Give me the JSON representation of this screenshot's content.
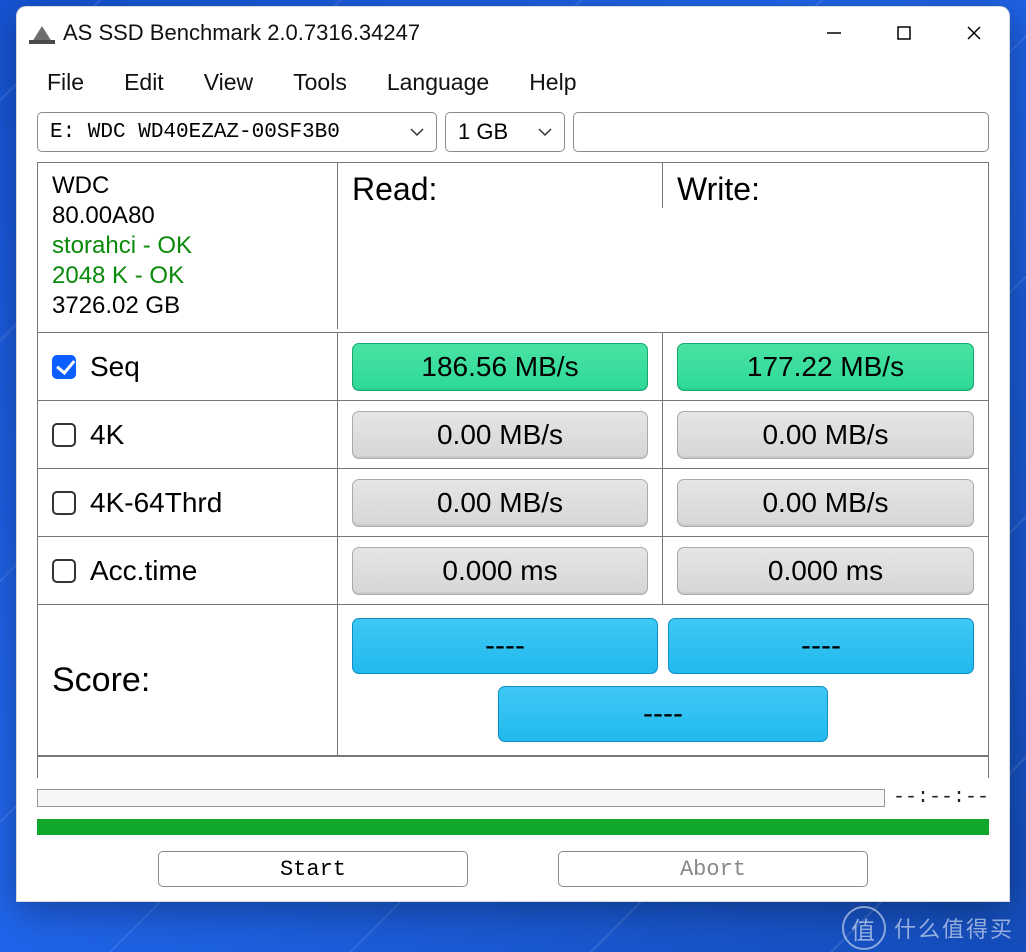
{
  "window_title": "AS SSD Benchmark 2.0.7316.34247",
  "menu": {
    "file": "File",
    "edit": "Edit",
    "view": "View",
    "tools": "Tools",
    "language": "Language",
    "help": "Help"
  },
  "toolbar": {
    "drive_selected": "E: WDC WD40EZAZ-00SF3B0",
    "size_selected": "1 GB"
  },
  "drive_info": {
    "name": "WDC",
    "firmware": "80.00A80",
    "driver_status": "storahci - OK",
    "alignment_status": "2048 K - OK",
    "capacity": "3726.02 GB"
  },
  "columns": {
    "read": "Read:",
    "write": "Write:"
  },
  "tests": {
    "seq": {
      "label": "Seq",
      "checked": true,
      "read": "186.56 MB/s",
      "write": "177.22 MB/s",
      "highlight": true
    },
    "k4": {
      "label": "4K",
      "checked": false,
      "read": "0.00 MB/s",
      "write": "0.00 MB/s",
      "highlight": false
    },
    "k4_64": {
      "label": "4K-64Thrd",
      "checked": false,
      "read": "0.00 MB/s",
      "write": "0.00 MB/s",
      "highlight": false
    },
    "acc": {
      "label": "Acc.time",
      "checked": false,
      "read": "0.000 ms",
      "write": "0.000 ms",
      "highlight": false
    }
  },
  "score": {
    "label": "Score:",
    "read": "----",
    "write": "----",
    "total": "----"
  },
  "elapsed": "--:--:--",
  "buttons": {
    "start": "Start",
    "abort": "Abort"
  },
  "watermark": {
    "badge": "值",
    "text": "什么值得买"
  }
}
